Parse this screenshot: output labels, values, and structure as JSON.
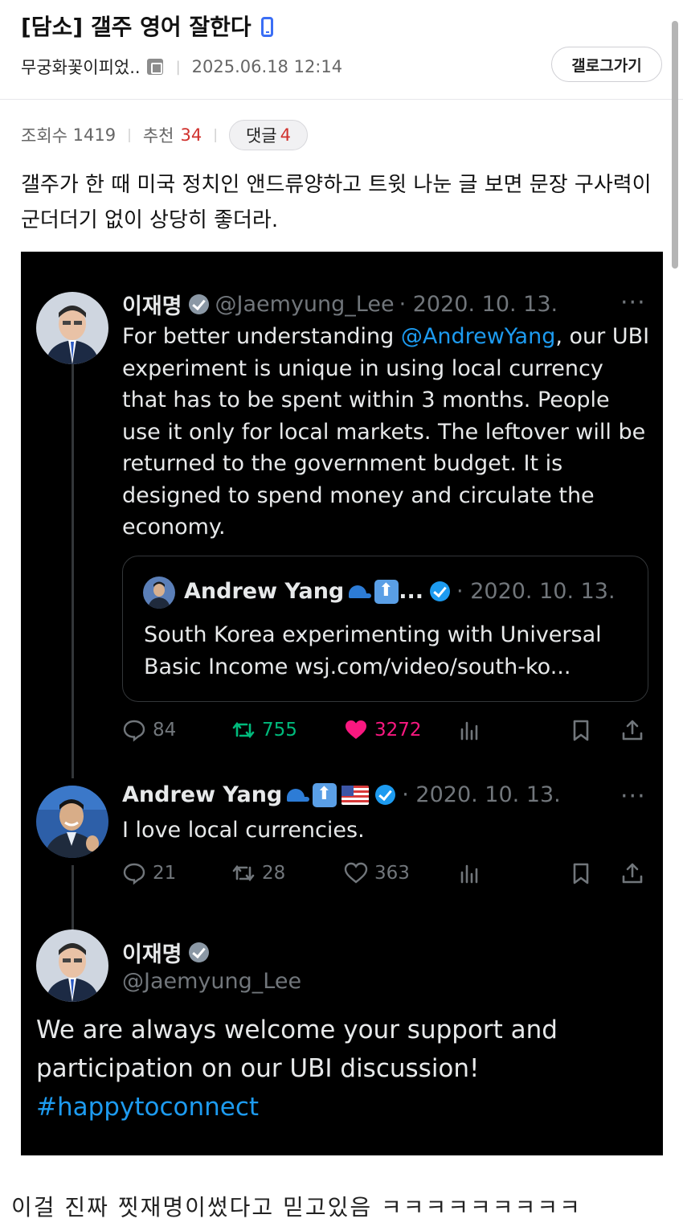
{
  "post": {
    "title": "[담소] 갤주 영어 잘한다",
    "author": "무궁화꽃이피었..",
    "datetime": "2025.06.18 12:14",
    "gallery_button": "갤로그가기",
    "views_label": "조회수",
    "views": "1419",
    "recommend_label": "추천",
    "recommend": "34",
    "comments_label": "댓글",
    "comments": "4",
    "body": "갤주가 한 때 미국 정치인 앤드류양하고 트윗 나눈 글 보면 문장 구사력이 군더더기 없이 상당히 좋더라.",
    "footer_text": "이걸 진짜 찟재명이썼다고 믿고있음 ㅋㅋㅋㅋㅋㅋㅋㅋㅋ"
  },
  "tweets": {
    "t1": {
      "name": "이재명",
      "handle": "@Jaemyung_Lee",
      "date": "· 2020. 10. 13.",
      "more": "···",
      "text_before": "For better understanding ",
      "mention": "@AndrewYang",
      "text_after": ", our UBI experiment is unique in using local currency that has to be spent within 3 months. People use it only for local markets. The leftover will be returned to the government budget. It is designed to spend money and circulate the economy.",
      "quote": {
        "name": "Andrew Yang",
        "ellipsis": "...",
        "date": "· 2020. 10. 13.",
        "text": "South Korea experimenting with Universal Basic Income wsj.com/video/south-ko..."
      },
      "replies": "84",
      "retweets": "755",
      "likes": "3272"
    },
    "t2": {
      "name": "Andrew Yang",
      "date": "· 2020. 10. 13.",
      "more": "···",
      "text": "I love local currencies.",
      "replies": "21",
      "retweets": "28",
      "likes": "363"
    },
    "t3": {
      "name": "이재명",
      "handle": "@Jaemyung_Lee",
      "text": "We are always welcome your support and participation on our UBI discussion!",
      "hashtag": "#happytoconnect"
    }
  },
  "colors": {
    "accent_red": "#d0312d",
    "twitter_blue": "#1d9bf0",
    "retweet_green": "#00ba7c",
    "like_pink": "#f91880"
  }
}
